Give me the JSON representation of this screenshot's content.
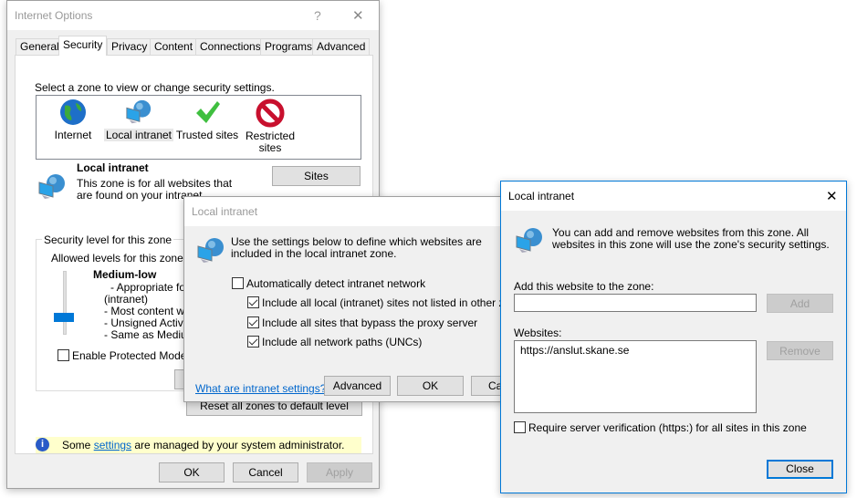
{
  "internet_options": {
    "title": "Internet Options",
    "help": "?",
    "close": "✕",
    "tabs": [
      "General",
      "Security",
      "Privacy",
      "Content",
      "Connections",
      "Programs",
      "Advanced"
    ],
    "active_tab": "Security",
    "zone_prompt": "Select a zone to view or change security settings.",
    "zones": [
      {
        "label": "Internet",
        "icon": "globe-icon"
      },
      {
        "label": "Local intranet",
        "icon": "intranet-icon"
      },
      {
        "label": "Trusted sites",
        "icon": "checkmark-icon"
      },
      {
        "label": "Restricted sites",
        "icon": "no-entry-icon"
      }
    ],
    "selected_zone": "Local intranet",
    "zone_name": "Local intranet",
    "zone_desc": "This zone is for all websites that are found on your intranet.",
    "sites_button": "Sites",
    "security_group": "Security level for this zone",
    "allowed_levels": "Allowed levels for this zone: All",
    "level_name": "Medium-low",
    "level_lines": [
      "- Appropriate for we",
      "(intranet)",
      "- Most content will b",
      "- Unsigned ActiveX c",
      "- Same as Medium le"
    ],
    "protected_mode": "Enable Protected Mode (rec",
    "protected_mode_checked": false,
    "custom_button": "Cu",
    "reset_button": "Reset all zones to default level",
    "info_pre": "Some ",
    "info_link": "settings",
    "info_post": " are managed by your system administrator.",
    "ok": "OK",
    "cancel": "Cancel",
    "apply": "Apply"
  },
  "intranet_dialog": {
    "title": "Local intranet",
    "desc": "Use the settings below to define which websites are included in the local intranet zone.",
    "options": [
      {
        "label": "Automatically detect intranet network",
        "checked": false
      },
      {
        "label": "Include all local (intranet) sites not listed in other zones",
        "checked": true
      },
      {
        "label": "Include all sites that bypass the proxy server",
        "checked": true
      },
      {
        "label": "Include all network paths (UNCs)",
        "checked": true
      }
    ],
    "help_link": "What are intranet settings?",
    "advanced": "Advanced",
    "ok": "OK",
    "cancel": "Ca"
  },
  "sites_dialog": {
    "title": "Local intranet",
    "close": "✕",
    "desc": "You can add and remove websites from this zone. All websites in this zone will use the zone's security settings.",
    "add_label": "Add this website to the zone:",
    "add_value": "",
    "add_button": "Add",
    "websites_label": "Websites:",
    "websites": [
      "https://anslut.skane.se"
    ],
    "remove_button": "Remove",
    "require_https": "Require server verification (https:) for all sites in this zone",
    "require_https_checked": false,
    "close_button": "Close",
    "accent": "#0078d7"
  }
}
